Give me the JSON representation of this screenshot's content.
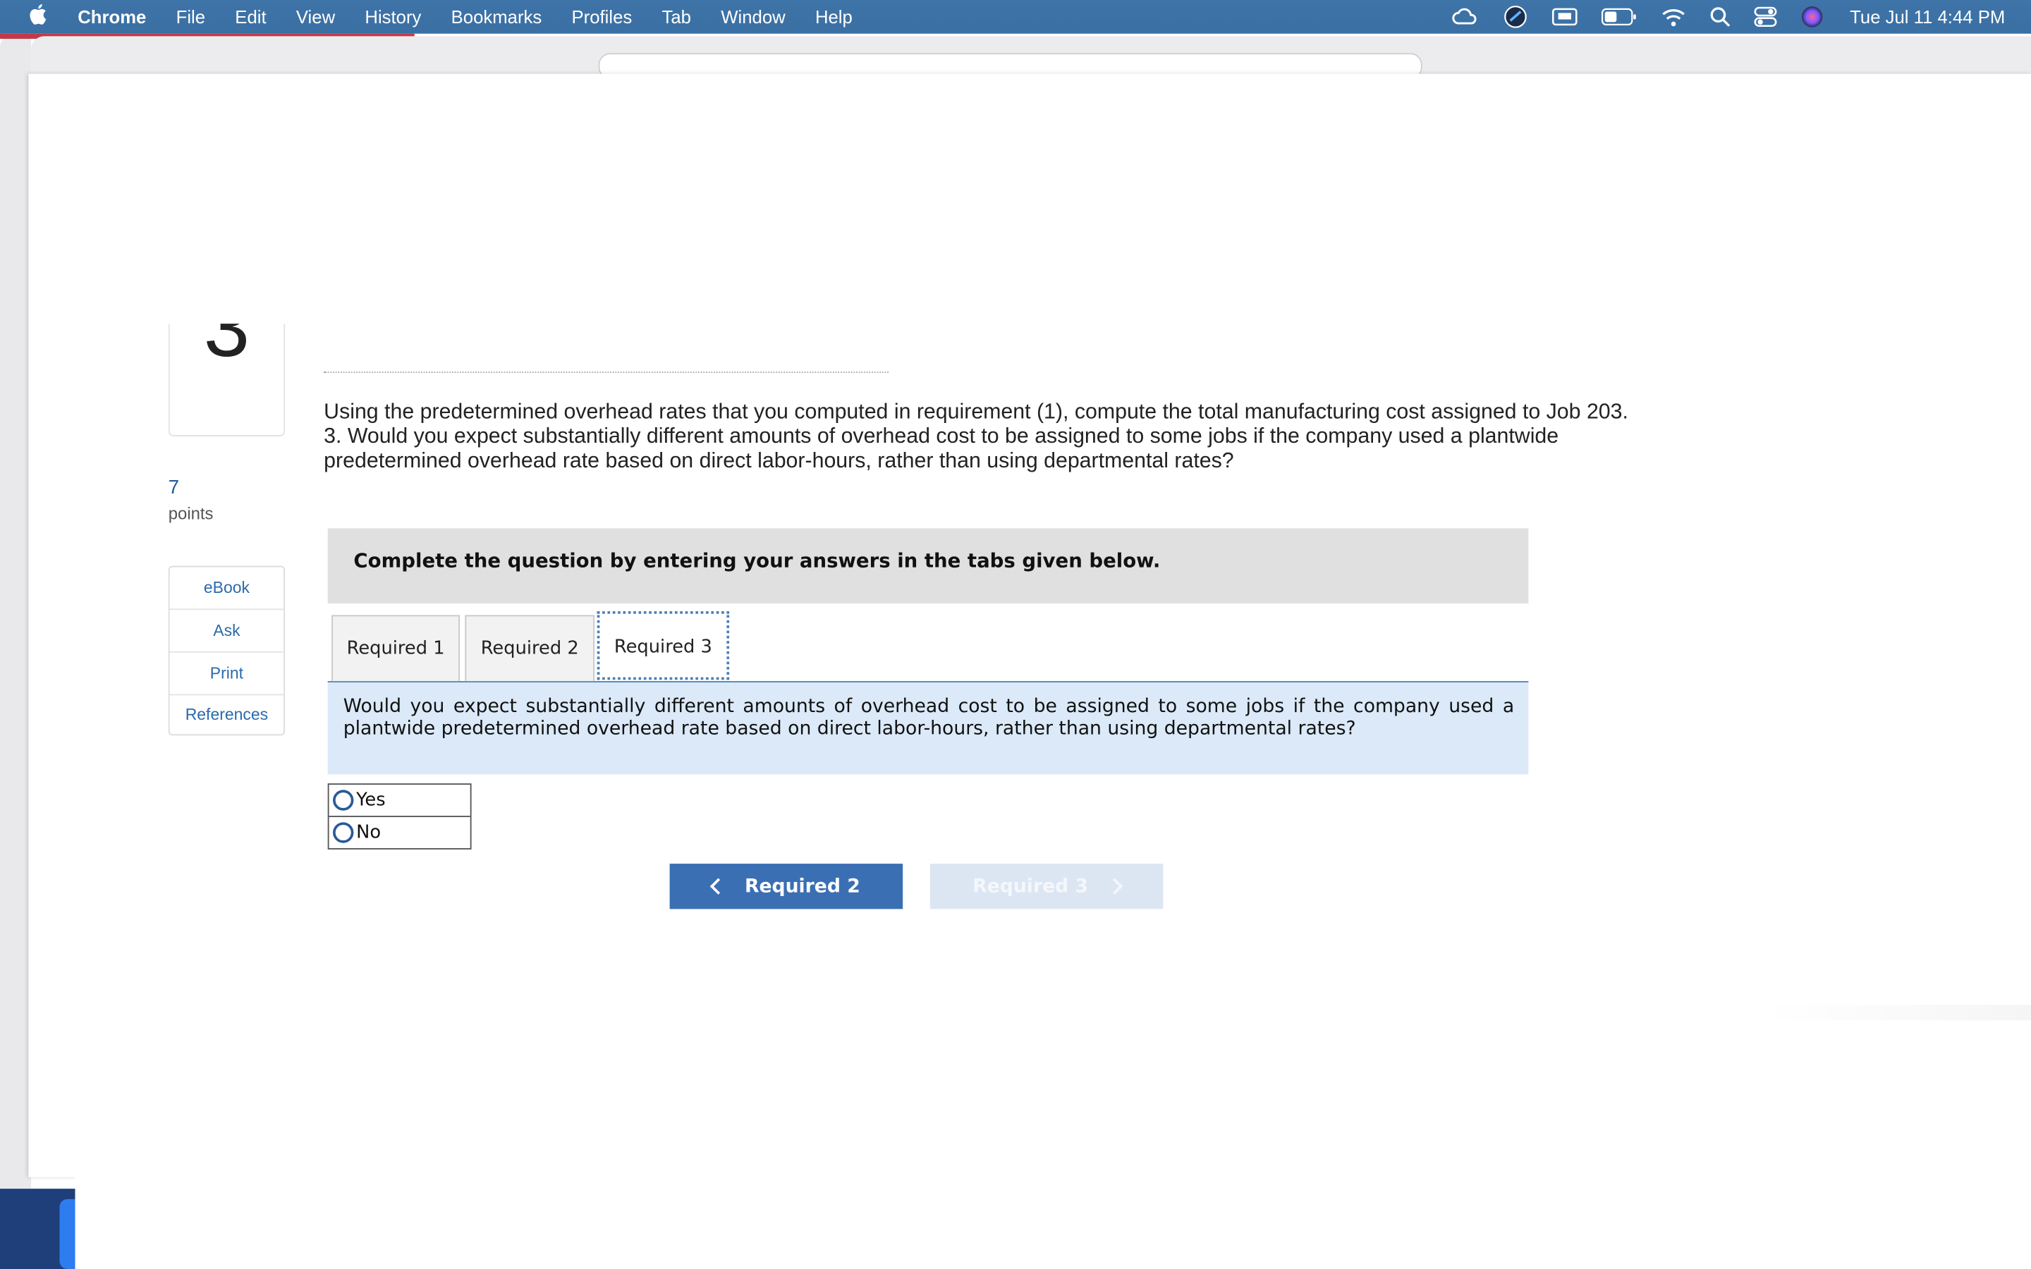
{
  "menubar": {
    "apple_icon": "apple-logo-icon",
    "app_name": "Chrome",
    "items": [
      "File",
      "Edit",
      "View",
      "History",
      "Bookmarks",
      "Profiles",
      "Tab",
      "Window",
      "Help"
    ],
    "clock": "Tue Jul 11  4:44 PM",
    "status_icons": [
      "creative-cloud-icon",
      "vpn-icon",
      "display-icon",
      "battery-icon",
      "wifi-icon",
      "spotlight-search-icon",
      "control-center-icon",
      "siri-icon"
    ]
  },
  "question": {
    "number": "3",
    "points_value": "7",
    "points_label": "points"
  },
  "sidebar": {
    "tools": [
      "eBook",
      "Ask",
      "Print",
      "References"
    ]
  },
  "prompt": {
    "line1": "Using the predetermined overhead rates that you computed in requirement (1), compute the total manufacturing cost assigned to Job 203.",
    "line2": "3. Would you expect substantially different amounts of overhead cost to be assigned to some jobs if the company used a plantwide predetermined overhead rate based on direct labor-hours, rather than using departmental rates?"
  },
  "instruction": "Complete the question by entering your answers in the tabs given below.",
  "tabs": [
    "Required 1",
    "Required 2",
    "Required 3"
  ],
  "active_tab": "Required 3",
  "panel_question": "Would you expect substantially different amounts of overhead cost to be assigned to some jobs if the company used a plantwide predetermined overhead rate based on direct labor-hours, rather than using departmental rates?",
  "options": [
    "Yes",
    "No"
  ],
  "nav": {
    "prev_label": "Required 2",
    "next_label": "Required 3"
  },
  "colors": {
    "menubar": "#3a6fa3",
    "primary_button": "#3a6fb4",
    "disabled_button": "#dce6f3",
    "panel_bg": "#dbe9f8",
    "instruction_bg": "#e0e0e0"
  }
}
